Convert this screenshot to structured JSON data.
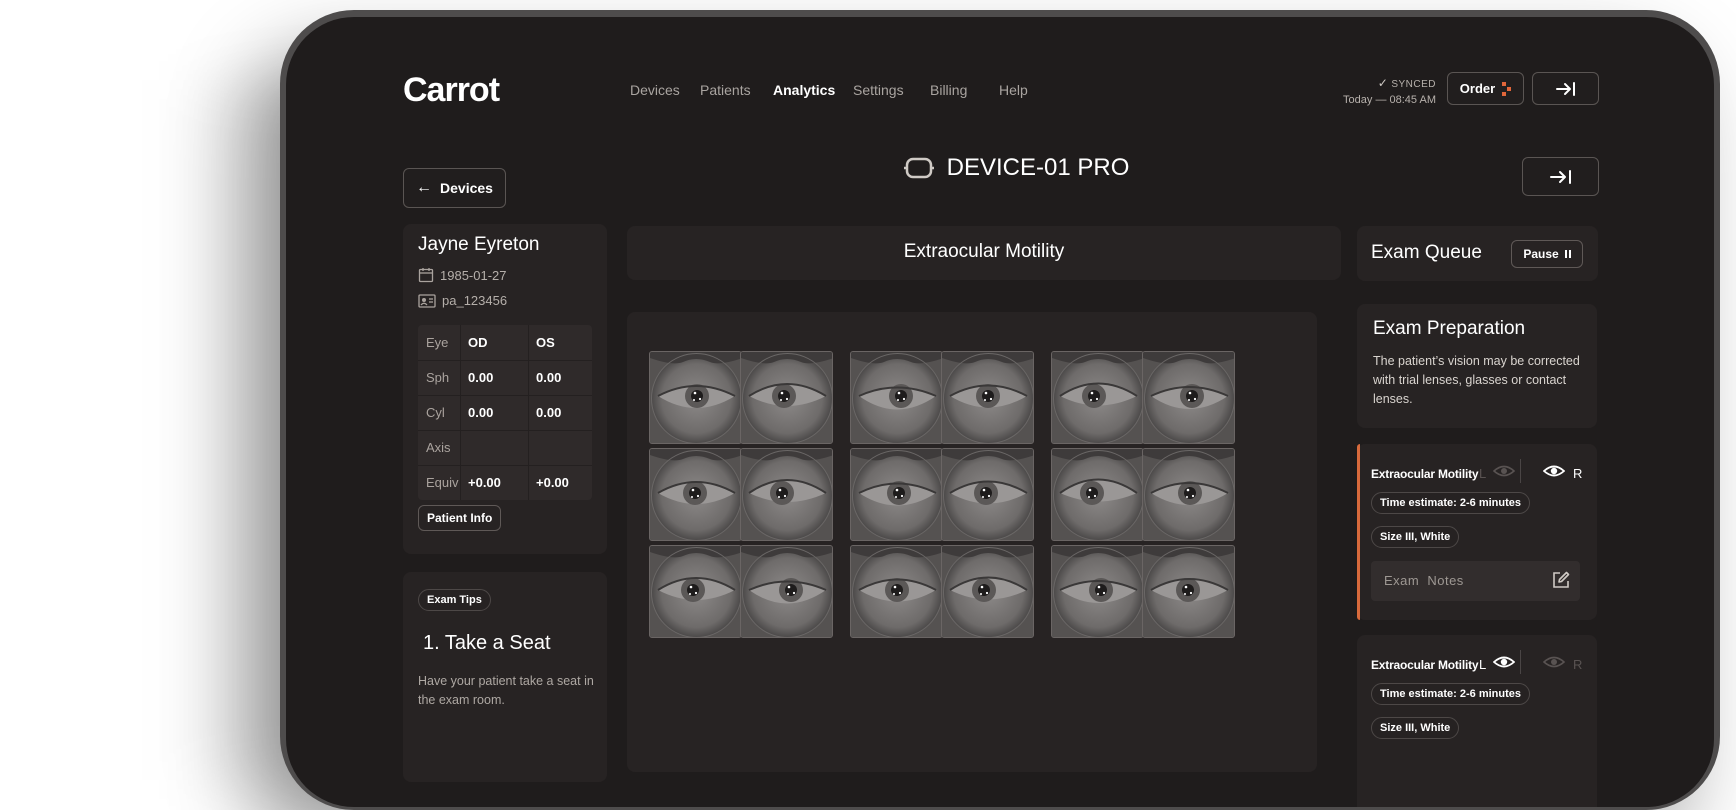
{
  "app": {
    "logo": "Carrot"
  },
  "nav": {
    "items": [
      {
        "label": "Devices",
        "active": false
      },
      {
        "label": "Patients",
        "active": false
      },
      {
        "label": "Analytics",
        "active": true
      },
      {
        "label": "Settings",
        "active": false
      },
      {
        "label": "Billing",
        "active": false
      },
      {
        "label": "Help",
        "active": false
      }
    ]
  },
  "sync": {
    "status": "SYNCED",
    "time": "Today — 08:45 AM"
  },
  "header": {
    "order_label": "Order",
    "back_label": "Devices",
    "device_name": "DEVICE-01 PRO"
  },
  "patient": {
    "name": "Jayne Eyreton",
    "dob": "1985-01-27",
    "id": "pa_123456",
    "rx": {
      "headers": [
        "Eye",
        "OD",
        "OS"
      ],
      "rows": [
        {
          "label": "Sph",
          "od": "0.00",
          "os": "0.00"
        },
        {
          "label": "Cyl",
          "od": "0.00",
          "os": "0.00"
        },
        {
          "label": "Axis",
          "od": "",
          "os": ""
        },
        {
          "label": "Equiv",
          "od": "+0.00",
          "os": "+0.00"
        }
      ]
    },
    "info_button": "Patient Info"
  },
  "tips": {
    "chip": "Exam Tips",
    "title": "1. Take a Seat",
    "body": "Have your patient take a seat in the exam room."
  },
  "exam": {
    "title": "Extraocular Motility"
  },
  "queue": {
    "title": "Exam Queue",
    "pause_label": "Pause",
    "prep_title": "Exam Preparation",
    "prep_body": "The patient’s vision may be corrected with trial lenses, glasses or contact lenses.",
    "cards": [
      {
        "label": "Extraocular Motility",
        "left": "L",
        "right": "R",
        "active_eye": "R",
        "time": "Time estimate: 2-6 minutes",
        "size": "Size III, White",
        "notes": "Exam Notes"
      },
      {
        "label": "Extraocular Motility",
        "left": "L",
        "right": "R",
        "active_eye": "L",
        "time": "Time estimate: 2-6 minutes",
        "size": "Size III, White"
      }
    ]
  },
  "colors": {
    "accent": "#d86a3c",
    "background": "#1f1c1c",
    "panel": "#272323"
  }
}
